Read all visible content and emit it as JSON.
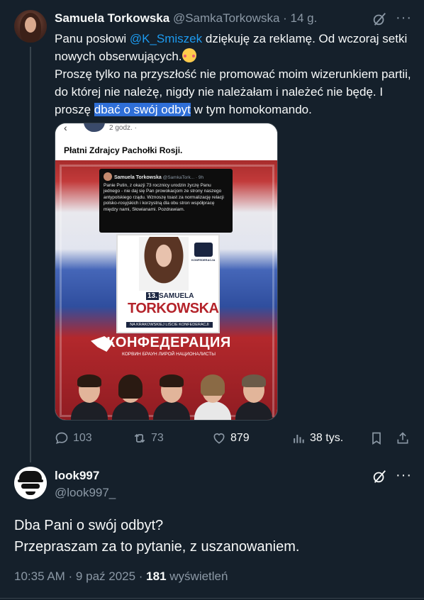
{
  "tweet": {
    "author_name": "Samuela Torkowska",
    "author_handle": "@SamkaTorkowska",
    "separator": "·",
    "time": "14 g.",
    "text_part1": "Panu posłowi ",
    "mention": "@K_Smiszek",
    "text_part2": " dziękuję za reklamę. Od wczoraj setki nowych obserwujących.",
    "emoji": "smiling-face-with-hearts",
    "text_part3": "Proszę tylko na przyszłość nie promować moim wizerunkiem partii, do której nie należę, nigdy nie należałam i należeć nie będę. I proszę ",
    "highlighted": "dbać o swój odbyt",
    "text_part4": " w tym homokomando.",
    "media": {
      "post_time": "2 godz. ·",
      "post_title": "Płatni Zdrajcy Pachołki Rosji.",
      "quote_name": "Samuela Torkowska",
      "quote_handle": "@SamkaTork... · 9h",
      "quote_text": "Panie Putin, z okazji 73 rocznicy urodzin życzę Panu jednego - nie daj się Pan prowokacjom ze strony naszego antypolskiego rządu. Wznoszę toast za normalizację relacji polsko-rosyjskich i korzystną dla obu stron współpracę między nami, Słowianami. Pozdrawiam.",
      "card_number": "13.",
      "card_first_name": "SAMUELA",
      "card_last_name": "TORKOWSKA",
      "card_subtitle": "NA KRAKOWSKIEJ LIŚCIE KONFEDERACJI",
      "card_logo_text": "KONFEDERACJA",
      "brand_name": "КОНФЕДЕРАЦИЯ",
      "brand_subtitle": "КОРВИН БРАУН ЛИРОЙ НАЦИОНАЛИСТЫ"
    },
    "actions": {
      "replies": "103",
      "reposts": "73",
      "likes": "879",
      "views": "38 tys."
    }
  },
  "reply": {
    "author_name": "look997",
    "author_handle": "@look997_",
    "line1": "Dba Pani o swój odbyt?",
    "line2": "Przepraszam za to pytanie, z uszanowaniem.",
    "time": "10:35 AM · 9 paź 2025 · ",
    "views_count": "181",
    "views_label": " wyświetleń"
  },
  "colors": {
    "background": "#15202b",
    "text": "#f7f9f9",
    "muted": "#8b98a5",
    "accent": "#1d9bf0",
    "selection": "#2f6fd8"
  }
}
